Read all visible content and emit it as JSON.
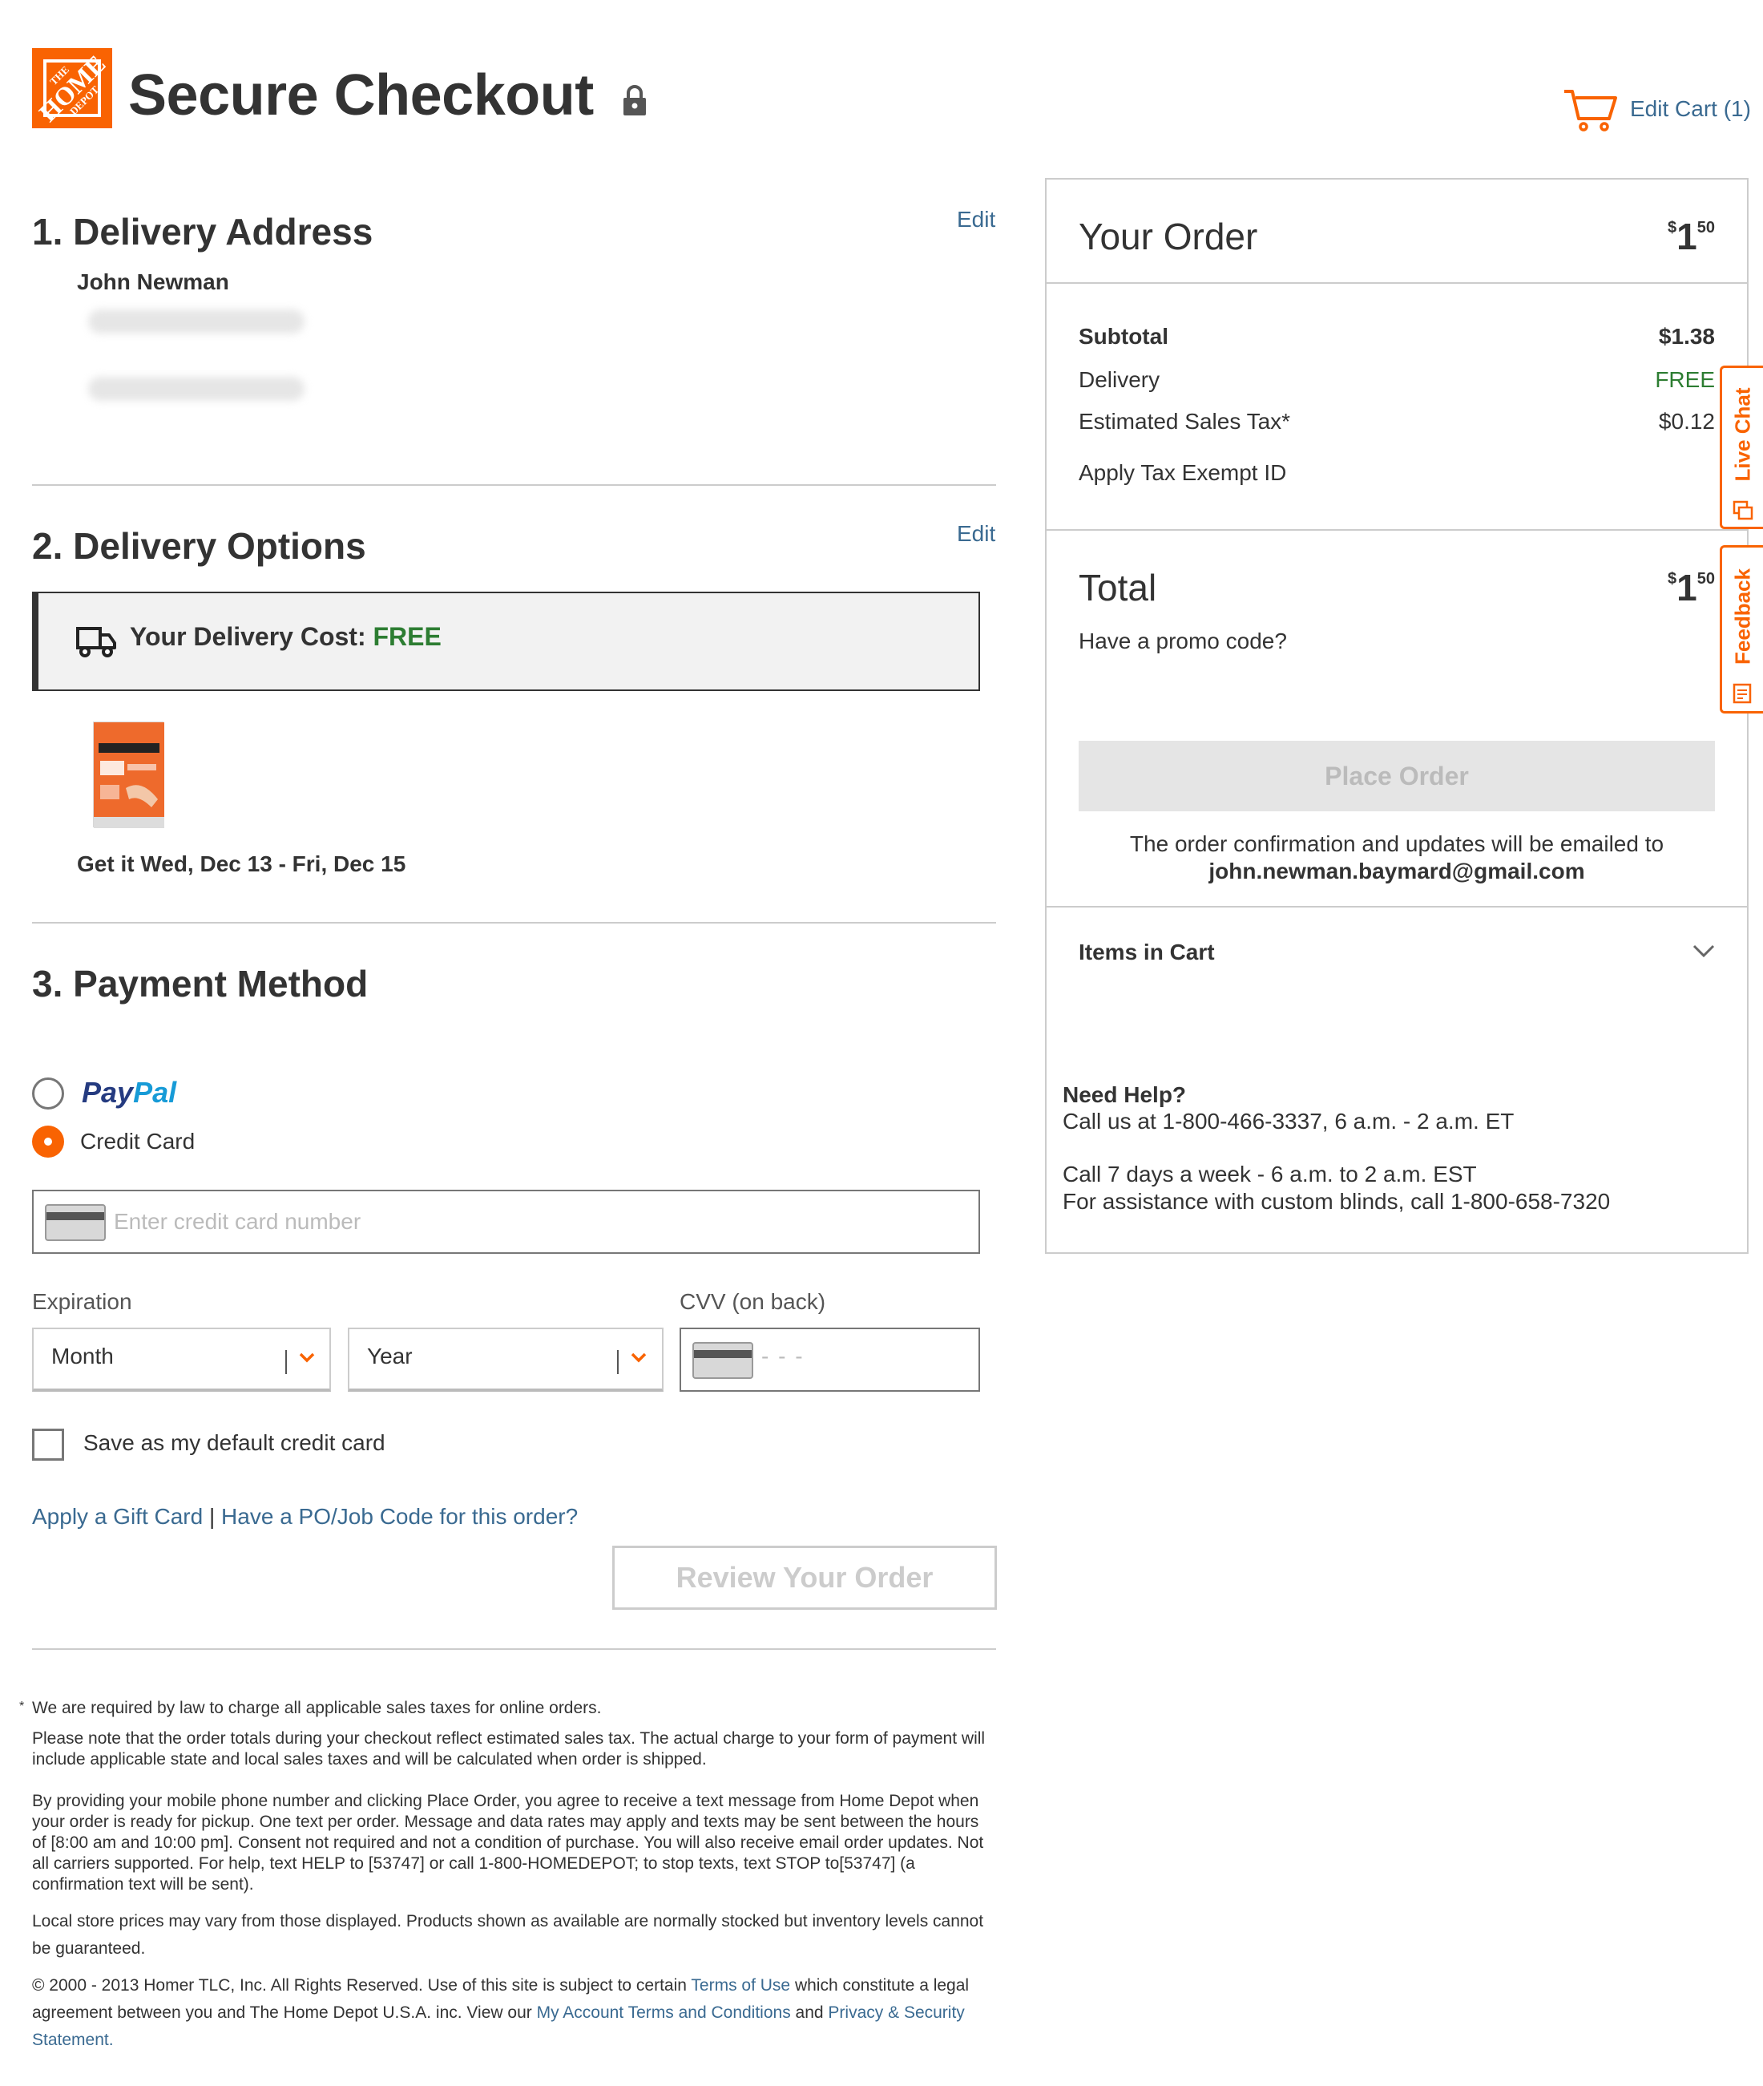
{
  "header": {
    "logo_text_line1": "THE",
    "logo_text_line2": "HOME",
    "logo_text_line3": "DEPOT",
    "title": "Secure Checkout",
    "cart_label": "Edit Cart (1)"
  },
  "delivery_address": {
    "title": "1. Delivery Address",
    "edit_label": "Edit",
    "name": "John Newman"
  },
  "delivery_options": {
    "title": "2. Delivery Options",
    "edit_label": "Edit",
    "cost_label": "Your Delivery Cost:",
    "cost_value": "FREE",
    "date_text": "Get it Wed, Dec 13 - Fri, Dec 15"
  },
  "payment": {
    "title": "3. Payment Method",
    "paypal_pay": "Pay",
    "paypal_pal": "Pal",
    "credit_card_label": "Credit Card",
    "cc_placeholder": "Enter credit card number",
    "expiration_label": "Expiration",
    "cvv_label": "CVV (on back)",
    "month_value": "Month",
    "year_value": "Year",
    "cvv_placeholder": "- - -",
    "save_default_label": "Save as my default credit card",
    "gift_card_link": "Apply a Gift Card",
    "separator": "|",
    "po_code_link": "Have a PO/Job Code for this order?",
    "review_button": "Review Your Order"
  },
  "footnotes": {
    "star": "*",
    "tax_line": "We are required by law to charge all applicable sales taxes for online orders.",
    "estimated_tax": "Please note that the order totals during your checkout reflect estimated sales tax. The actual charge to your form of payment will include applicable state and local sales taxes and will be calculated when order is shipped.",
    "sms": "By providing your mobile phone number and clicking Place Order, you agree to receive a text message from Home Depot when your order is ready for pickup. One text per order. Message and data rates may apply and texts may be sent between the hours of [8:00 am and 10:00 pm]. Consent not required and not a condition of purchase. You will also receive email order updates. Not all carriers supported. For help, text HELP to [53747] or call 1-800-HOMEDEPOT; to stop texts, text STOP to[53747] (a confirmation text will be sent).",
    "local_prices": "Local store prices may vary from those displayed. Products shown as available are normally stocked but inventory levels cannot be guaranteed.",
    "copyright_a": "© 2000 - 2013 Homer TLC, Inc. All Rights Reserved. Use of this site is subject to certain ",
    "terms_link": "Terms of Use",
    "copyright_b": " which constitute a legal agreement between you and The Home Depot U.S.A. inc. View our ",
    "account_terms_link": "My Account Terms and Conditions",
    "copyright_c": " and ",
    "privacy_link": "Privacy & Security Statement."
  },
  "order_summary": {
    "title": "Your Order",
    "header_price_symbol": "$",
    "header_price_dollars": "1",
    "header_price_cents": "50",
    "subtotal_label": "Subtotal",
    "subtotal_value": "$1.38",
    "delivery_label": "Delivery",
    "delivery_value": "FREE",
    "tax_label": "Estimated Sales Tax*",
    "tax_value": "$0.12",
    "tax_exempt_link": "Apply Tax Exempt ID",
    "total_label": "Total",
    "total_symbol": "$",
    "total_dollars": "1",
    "total_cents": "50",
    "promo_link": "Have a promo code?",
    "place_order_button": "Place Order",
    "confirm_text": "The order confirmation and updates will be emailed to",
    "email": "john.newman.baymard@gmail.com",
    "items_in_cart": "Items in Cart",
    "help_title": "Need Help?",
    "help_line1": "Call us at 1-800-466-3337, 6 a.m. - 2 a.m. ET",
    "help_line2": "Call 7 days a week - 6 a.m. to 2 a.m. EST",
    "help_line3": "For assistance with custom blinds, call 1-800-658-7320"
  },
  "side_tabs": {
    "live_chat": "Live Chat",
    "feedback": "Feedback"
  },
  "colors": {
    "brand_orange": "#f96302",
    "link_blue": "#3a6a91",
    "free_green": "#2d7d32"
  }
}
